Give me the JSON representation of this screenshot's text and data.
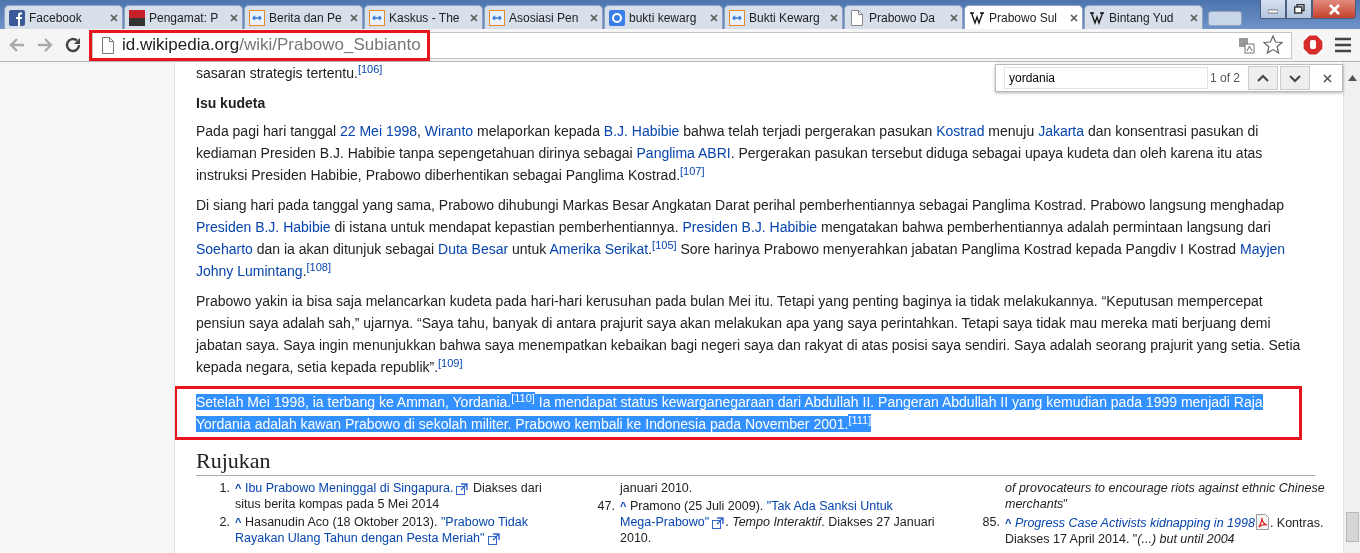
{
  "tabs": [
    {
      "kind": "fb",
      "title": "Facebook",
      "selected": false
    },
    {
      "kind": "news",
      "title": "Pengamat: P",
      "selected": false
    },
    {
      "kind": "box",
      "title": "Berita dan Pe",
      "selected": false
    },
    {
      "kind": "box",
      "title": "Kaskus - The",
      "selected": false
    },
    {
      "kind": "box",
      "title": "Asosiasi Pen",
      "selected": false
    },
    {
      "kind": "google",
      "title": "bukti kewarg",
      "selected": false
    },
    {
      "kind": "box",
      "title": "Bukti Kewarg",
      "selected": false
    },
    {
      "kind": "page",
      "title": "Prabowo Da",
      "selected": false
    },
    {
      "kind": "wiki",
      "title": "Prabowo Sul",
      "selected": true
    },
    {
      "kind": "wiki",
      "title": "Bintang Yud",
      "selected": false
    }
  ],
  "address_bar": {
    "host": "id.wikipedia.org",
    "path": "/wiki/Prabowo_Subianto",
    "annotated": true
  },
  "find_bar": {
    "value": "yordania",
    "count": "1 of 2"
  },
  "article": [
    {
      "kind": "p",
      "selected": false,
      "annotated": false,
      "segments": [
        {
          "kind": "text",
          "t": "sasaran strategis tertentu."
        },
        {
          "kind": "ref",
          "t": "[106]"
        }
      ]
    },
    {
      "kind": "h",
      "selected": false,
      "annotated": false,
      "segments": [
        {
          "kind": "text",
          "t": "Isu kudeta"
        }
      ]
    },
    {
      "kind": "p",
      "selected": false,
      "annotated": false,
      "segments": [
        {
          "kind": "text",
          "t": "Pada pagi hari tanggal "
        },
        {
          "kind": "link",
          "t": "22 Mei 1998"
        },
        {
          "kind": "text",
          "t": ", "
        },
        {
          "kind": "link",
          "t": "Wiranto"
        },
        {
          "kind": "text",
          "t": " melaporkan kepada "
        },
        {
          "kind": "link",
          "t": "B.J. Habibie"
        },
        {
          "kind": "text",
          "t": " bahwa telah terjadi pergerakan pasukan "
        },
        {
          "kind": "link",
          "t": "Kostrad"
        },
        {
          "kind": "text",
          "t": " menuju "
        },
        {
          "kind": "link",
          "t": "Jakarta"
        },
        {
          "kind": "text",
          "t": " dan konsentrasi pasukan di kediaman Presiden B.J. Habibie tanpa sepengetahuan dirinya sebagai "
        },
        {
          "kind": "link",
          "t": "Panglima ABRI"
        },
        {
          "kind": "text",
          "t": ". Pergerakan pasukan tersebut diduga sebagai upaya kudeta dan oleh karena itu atas instruksi Presiden Habibie, Prabowo diberhentikan sebagai Panglima Kostrad."
        },
        {
          "kind": "ref",
          "t": "[107]"
        }
      ]
    },
    {
      "kind": "p",
      "selected": false,
      "annotated": false,
      "segments": [
        {
          "kind": "text",
          "t": "Di siang hari pada tanggal yang sama, Prabowo dihubungi Markas Besar Angkatan Darat perihal pemberhentiannya sebagai Panglima Kostrad. Prabowo langsung menghadap "
        },
        {
          "kind": "link",
          "t": "Presiden B.J. Habibie"
        },
        {
          "kind": "text",
          "t": " di istana untuk mendapat kepastian pemberhentiannya. "
        },
        {
          "kind": "link",
          "t": "Presiden B.J. Habibie"
        },
        {
          "kind": "text",
          "t": " mengatakan bahwa pemberhentiannya adalah permintaan langsung dari "
        },
        {
          "kind": "link",
          "t": "Soeharto"
        },
        {
          "kind": "text",
          "t": " dan ia akan ditunjuk sebagai "
        },
        {
          "kind": "link",
          "t": "Duta Besar"
        },
        {
          "kind": "text",
          "t": " untuk "
        },
        {
          "kind": "link",
          "t": "Amerika Serikat"
        },
        {
          "kind": "text",
          "t": "."
        },
        {
          "kind": "ref",
          "t": "[105]"
        },
        {
          "kind": "text",
          "t": " Sore harinya Prabowo menyerahkan jabatan Panglima Kostrad kepada Pangdiv I Kostrad "
        },
        {
          "kind": "link",
          "t": "Mayjen"
        },
        {
          "kind": "space"
        },
        {
          "kind": "link",
          "t": "Johny Lumintang"
        },
        {
          "kind": "text",
          "t": "."
        },
        {
          "kind": "ref",
          "t": "[108]"
        }
      ]
    },
    {
      "kind": "p",
      "selected": false,
      "annotated": false,
      "segments": [
        {
          "kind": "text",
          "t": "Prabowo yakin ia bisa saja melancarkan kudeta pada hari-hari kerusuhan pada bulan Mei itu. Tetapi yang penting baginya ia tidak melakukannya. “Keputusan mempercepat pensiun saya adalah sah,” ujarnya. “Saya tahu, banyak di antara prajurit saya akan melakukan apa yang saya perintahkan. Tetapi saya tidak mau mereka mati berjuang demi jabatan saya. Saya ingin menunjukkan bahwa saya menempatkan kebaikan bagi negeri saya dan rakyat di atas posisi saya sendiri. Saya adalah seorang prajurit yang setia. Setia kepada negara, setia kepada republik”."
        },
        {
          "kind": "ref",
          "t": "[109]"
        }
      ]
    },
    {
      "kind": "p",
      "selected": true,
      "annotated": true,
      "segments": [
        {
          "kind": "text",
          "t": "Setelah Mei 1998, ia terbang ke Amman, Yordania."
        },
        {
          "kind": "ref",
          "t": "[110]"
        },
        {
          "kind": "text",
          "t": " Ia mendapat status kewarganegaraan dari Abdullah II. Pangeran Abdullah II yang kemudian pada 1999 menjadi Raja Yordania adalah kawan Prabowo di sekolah militer. Prabowo kembali ke Indonesia pada November 2001."
        },
        {
          "kind": "ref",
          "t": "[111]"
        }
      ]
    }
  ],
  "references": {
    "title": "Rujukan",
    "columns": [
      {
        "items": [
          {
            "number": "1.",
            "segments": [
              {
                "kind": "backlink",
                "t": "^"
              },
              {
                "kind": "space"
              },
              {
                "kind": "link",
                "t": "Ibu Prabowo Meninggal di Singapura."
              },
              {
                "kind": "ext"
              },
              {
                "kind": "text",
                "t": " Diakses dari situs berita kompas pada 5 Mei 2014"
              }
            ]
          },
          {
            "number": "2.",
            "segments": [
              {
                "kind": "backlink",
                "t": "^"
              },
              {
                "kind": "text",
                "t": " Hasanudin Aco (18 Oktober 2013). "
              },
              {
                "kind": "link",
                "t": "\"Prabowo Tidak"
              },
              {
                "kind": "space"
              },
              {
                "kind": "link",
                "t": "Rayakan Ulang Tahun dengan Pesta Meriah\""
              },
              {
                "kind": "ext"
              }
            ]
          }
        ]
      },
      {
        "items": [
          {
            "segments": [
              {
                "kind": "text",
                "t": "januari 2010."
              }
            ]
          },
          {
            "number": "47.",
            "segments": [
              {
                "kind": "backlink",
                "t": "^"
              },
              {
                "kind": "text",
                "t": " Pramono (25 Juli 2009). "
              },
              {
                "kind": "link",
                "t": "\"Tak Ada Sanksi Untuk"
              },
              {
                "kind": "space"
              },
              {
                "kind": "link",
                "t": "Mega-Prabowo\""
              },
              {
                "kind": "ext"
              },
              {
                "kind": "text",
                "t": ". "
              },
              {
                "kind": "text",
                "t": "Tempo Interaktif",
                "italic": true
              },
              {
                "kind": "text",
                "t": ". Diakses 27 Januari 2010."
              }
            ]
          }
        ]
      },
      {
        "items": [
          {
            "segments": [
              {
                "kind": "text",
                "t": "of provocateurs to encourage riots against ethnic Chinese merchants",
                "italic": true
              },
              {
                "kind": "text",
                "t": "\""
              }
            ]
          },
          {
            "number": "85.",
            "segments": [
              {
                "kind": "backlink",
                "t": "^"
              },
              {
                "kind": "space"
              },
              {
                "kind": "link",
                "t": "Progress Case Activists kidnapping in 1998",
                "italic": true
              },
              {
                "kind": "pdf"
              },
              {
                "kind": "text",
                "t": ". Kontras. Diakses 17 April 2014. \""
              },
              {
                "kind": "text",
                "t": "(...) but until 2004",
                "italic": true
              }
            ]
          }
        ]
      }
    ]
  }
}
